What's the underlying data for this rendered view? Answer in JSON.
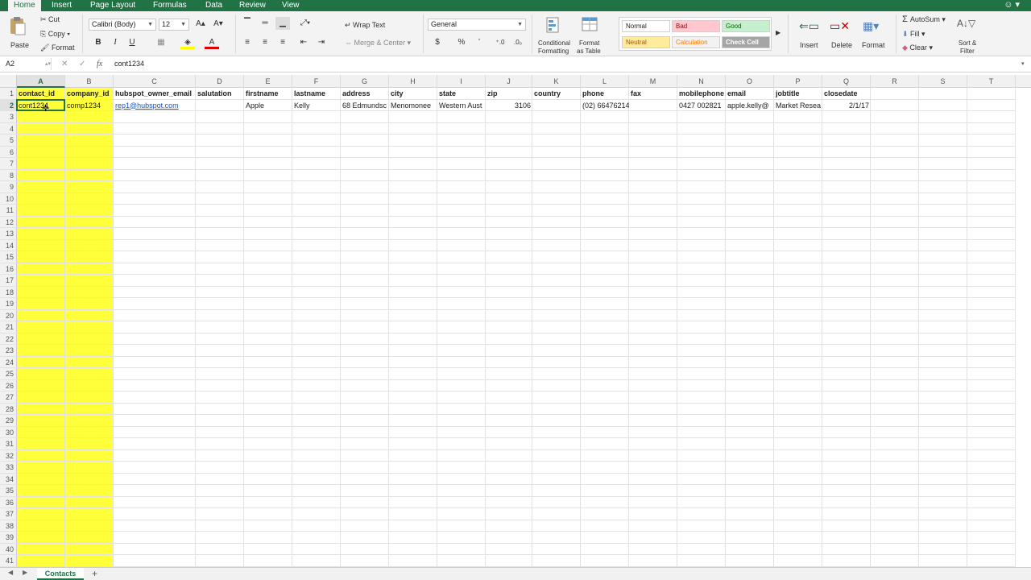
{
  "menu": {
    "tabs": [
      "Home",
      "Insert",
      "Page Layout",
      "Formulas",
      "Data",
      "Review",
      "View"
    ],
    "active": "Home"
  },
  "ribbon": {
    "clipboard": {
      "paste": "Paste",
      "cut": "Cut",
      "copy": "Copy",
      "format": "Format"
    },
    "font": {
      "name": "Calibri (Body)",
      "size": "12",
      "bold": "B",
      "italic": "I",
      "underline": "U"
    },
    "alignment": {
      "wrap_text": "Wrap Text",
      "merge_center": "Merge & Center"
    },
    "number": {
      "format": "General",
      "currency": "$",
      "percent": "%",
      "comma": "’"
    },
    "styles": {
      "conditional": [
        "Conditional",
        "Formatting"
      ],
      "format_table": [
        "Format",
        "as Table"
      ],
      "cells": [
        {
          "label": "Normal",
          "bg": "#ffffff",
          "fg": "#222222"
        },
        {
          "label": "Bad",
          "bg": "#ffc7ce",
          "fg": "#9c0006"
        },
        {
          "label": "Good",
          "bg": "#c6efce",
          "fg": "#006100"
        },
        {
          "label": "Neutral",
          "bg": "#ffeb9c",
          "fg": "#9c5700"
        },
        {
          "label": "Calculation",
          "bg": "#f2f2f2",
          "fg": "#fa7d00"
        },
        {
          "label": "Check Cell",
          "bg": "#a5a5a5",
          "fg": "#ffffff"
        }
      ]
    },
    "cells_group": {
      "insert": "Insert",
      "delete": "Delete",
      "format": "Format"
    },
    "editing": {
      "autosum": "AutoSum",
      "fill": "Fill",
      "clear": "Clear",
      "sort_filter": [
        "Sort &",
        "Filter"
      ]
    }
  },
  "formula_bar": {
    "name_box": "A2",
    "fx": "fx",
    "value": "cont1234"
  },
  "grid": {
    "columns": [
      "A",
      "B",
      "C",
      "D",
      "E",
      "F",
      "G",
      "H",
      "I",
      "J",
      "K",
      "L",
      "M",
      "N",
      "O",
      "P",
      "Q",
      "R",
      "S",
      "T"
    ],
    "selected_column": "A",
    "row_count": 41,
    "selected_row": 2,
    "header_row": [
      "contact_id",
      "company_id",
      "hubspot_owner_email",
      "salutation",
      "firstname",
      "lastname",
      "address",
      "city",
      "state",
      "zip",
      "country",
      "phone",
      "fax",
      "mobilephone",
      "email",
      "jobtitle",
      "closedate",
      "",
      "",
      ""
    ],
    "data_row": [
      "cont1234",
      "comp1234",
      "rep1@hubspot.com",
      "",
      "Apple",
      "Kelly",
      "68 Edmundsc",
      "Menomonee",
      "Western Aust",
      "3106",
      "",
      "(02) 66476214",
      "",
      "0427 002821",
      "apple.kelly@",
      "Market Resea",
      "2/1/17",
      "",
      "",
      ""
    ],
    "highlight_color": "#ffff3a",
    "accent": "#217346"
  },
  "sheets": {
    "tabs": [
      "Contacts"
    ],
    "add": "+"
  }
}
